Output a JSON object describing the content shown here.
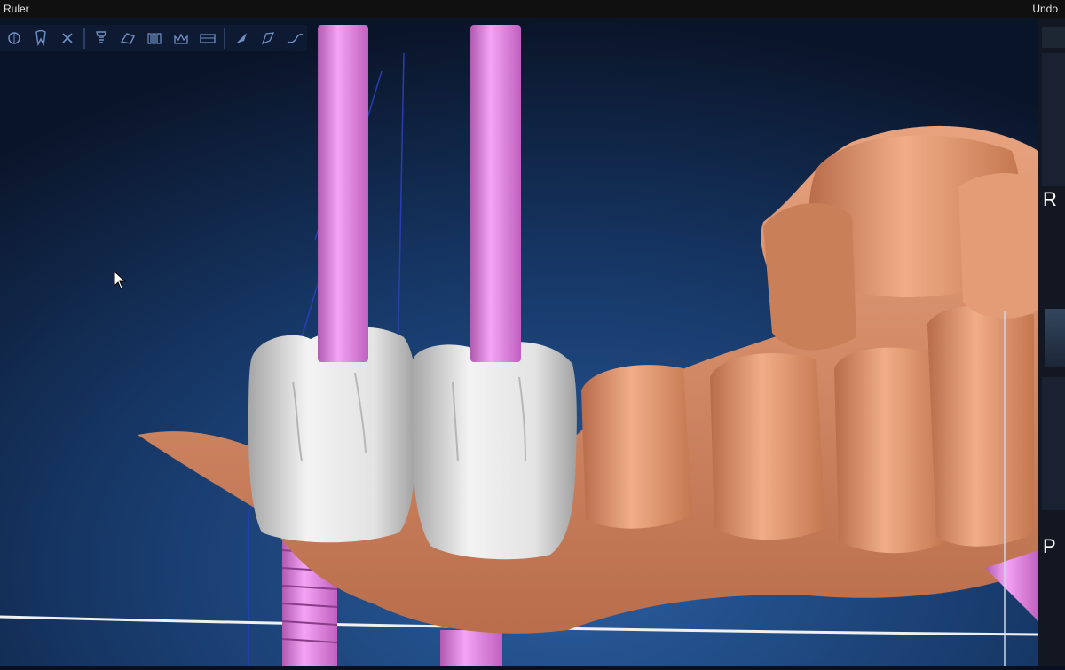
{
  "top_bar": {
    "left_label": "Ruler",
    "right_label": "Undo"
  },
  "right_panel": {
    "label_r": "R",
    "label_p": "P"
  },
  "toolbar": {
    "tools": [
      "compass-icon",
      "tooth-icon",
      "delete-icon",
      "implant-icon",
      "curve-icon",
      "teeth-set-icon",
      "crown-icon",
      "jaw-icon",
      "knife-icon",
      "polygon-cut-icon",
      "freehand-curve-icon"
    ]
  },
  "colors": {
    "background_top": "#0b1629",
    "background_bottom": "#1f4f8c",
    "jaw_model": "#d9906a",
    "crown": "#e2e2e2",
    "implant_axis": "#e07ce0",
    "guide_line": "#2a3eb0"
  }
}
